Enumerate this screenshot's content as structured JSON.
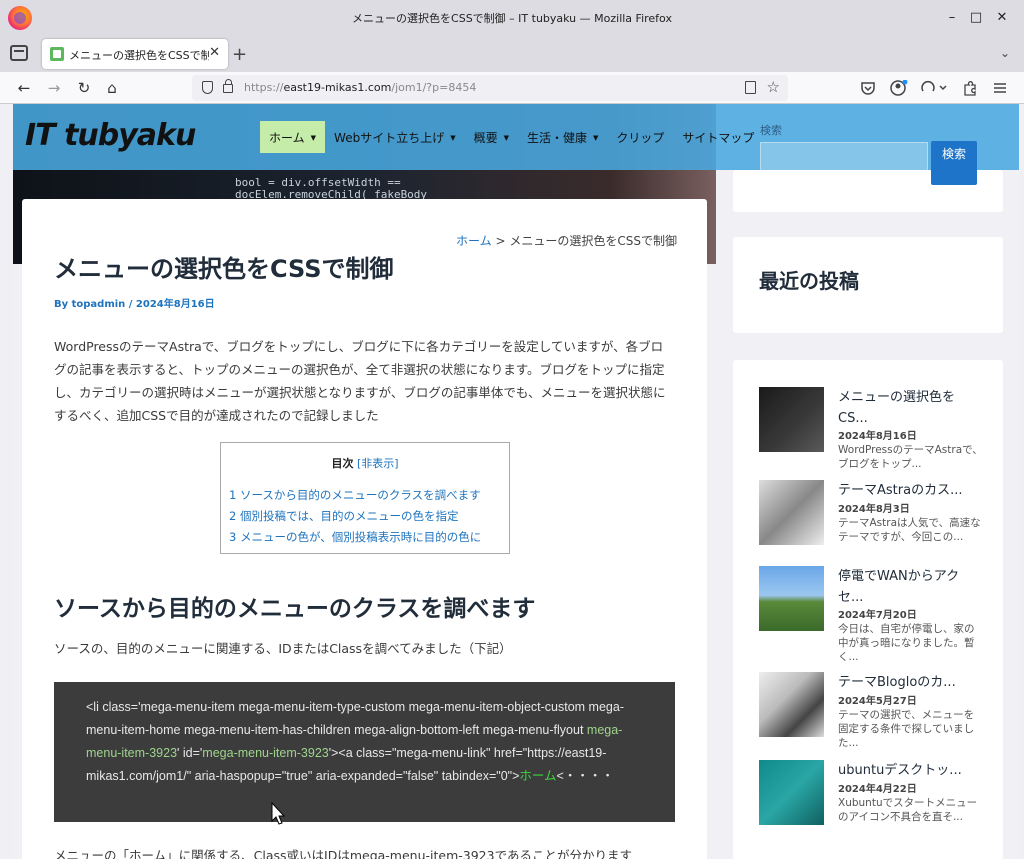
{
  "window": {
    "title": "メニューの選択色をCSSで制御 – IT tubyaku — Mozilla Firefox",
    "minimize": "–",
    "maximize": "□",
    "close": "✕"
  },
  "tab": {
    "title": "メニューの選択色をCSSで制御",
    "close": "✕",
    "new_tab": "+",
    "overflow": "⌄"
  },
  "nav": {
    "back": "←",
    "forward": "→",
    "reload": "↻",
    "home": "⌂",
    "url_prefix": "https://",
    "url_host": "east19-mikas1.com",
    "url_path": "/jom1/?p=8454",
    "star": "☆"
  },
  "toolbar_icons": [
    "pocket-icon",
    "account-icon",
    "sync-icon",
    "extensions-icon",
    "menu-icon"
  ],
  "site": {
    "logo": "IT tubyaku",
    "menu": [
      {
        "label": "ホーム",
        "caret": "▼",
        "active": true
      },
      {
        "label": "Webサイト立ち上げ",
        "caret": "▼"
      },
      {
        "label": "概要",
        "caret": "▼"
      },
      {
        "label": "生活・健康",
        "caret": "▼"
      },
      {
        "label": "クリップ",
        "caret": ""
      },
      {
        "label": "サイトマップ",
        "caret": ""
      }
    ],
    "search_label": "検索",
    "search_button": "検索"
  },
  "hero_code": [
    "bool = div.offsetWidth ==",
    "docElem.removeChild( fakeBody"
  ],
  "article": {
    "breadcrumb_home": "ホーム",
    "breadcrumb_sep": " > ",
    "breadcrumb_current": "メニューの選択色をCSSで制御",
    "title": "メニューの選択色をCSSで制御",
    "meta": "By topadmin / 2024年8月16日",
    "intro": "WordPressのテーマAstraで、ブログをトップにし、ブログに下に各カテゴリーを設定していますが、各ブログの記事を表示すると、トップのメニューの選択色が、全て非選択の状態になります。ブログをトップに指定し、カテゴリーの選択時はメニューが選択状態となりますが、ブログの記事単体でも、メニューを選択状態にするべく、追加CSSで目的が達成されたので記録しました",
    "toc_title": "目次",
    "toc_toggle": "[非表示]",
    "toc_items": [
      "1 ソースから目的のメニューのクラスを調べます",
      "2 個別投稿では、目的のメニューの色を指定",
      "3 メニューの色が、個別投稿表示時に目的の色に"
    ],
    "h2": "ソースから目的のメニューのクラスを調べます",
    "para2": "ソースの、目的のメニューに関連する、IDまたはClassを調べてみました（下記）",
    "code_a": "<li class='mega-menu-item mega-menu-item-type-custom mega-menu-item-object-custom mega-menu-item-home mega-menu-item-has-children mega-align-bottom-left mega-menu-flyout ",
    "code_b": "mega-menu-item-3923",
    "code_c": "' id='",
    "code_d": "mega-menu-item-3923",
    "code_e": "'><a class=\"mega-menu-link\" href=\"https://east19-mikas1.com/jom1/\" aria-haspopup=\"true\" aria-expanded=\"false\" tabindex=\"0\">",
    "code_f": "ホーム",
    "code_g": "<・・・・",
    "para3": "メニューの「ホーム」に関係する、Class或いはIDはmega-menu-item-3923であることが分かります"
  },
  "sidebar": {
    "recent_title": "最近の投稿",
    "posts": [
      {
        "title": "メニューの選択色をCS...",
        "date": "2024年8月16日",
        "excerpt": "WordPressのテーマAstraで、ブログをトップ..."
      },
      {
        "title": "テーマAstraのカス...",
        "date": "2024年8月3日",
        "excerpt": "テーマAstraは人気で、高速なテーマですが、今回この..."
      },
      {
        "title": "停電でWANからアクセ...",
        "date": "2024年7月20日",
        "excerpt": "今日は、自宅が停電し、家の中が真っ暗になりました。暫く..."
      },
      {
        "title": "テーマBlogloのカ...",
        "date": "2024年5月27日",
        "excerpt": "テーマの選択で、メニューを固定する条件で探していました..."
      },
      {
        "title": "ubuntuデスクトッ...",
        "date": "2024年4月22日",
        "excerpt": "Xubuntuでスタートメニューのアイコン不具合を直そ..."
      }
    ]
  },
  "colors": {
    "header": "#49a8e0",
    "accent": "#1e73be",
    "active_menu": "#c6ecaa",
    "code_bg": "#3c3c3c"
  }
}
